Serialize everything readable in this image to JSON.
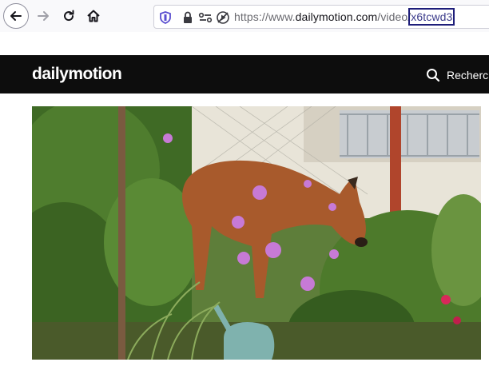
{
  "browser": {
    "url": {
      "prefix": "https://www.",
      "domain": "dailymotion.com",
      "path": "/video/",
      "video_id": "x6tcwd3"
    },
    "icons": [
      "back-icon",
      "forward-icon",
      "reload-icon",
      "home-icon",
      "shield-icon",
      "lock-icon",
      "permissions-icon",
      "autoplay-blocked-icon"
    ]
  },
  "site": {
    "logo": "dailymotion",
    "search_label": "Recherch"
  },
  "video": {
    "subject": "deer-in-garden-frame"
  },
  "colors": {
    "header_bg": "#0d0d0d",
    "url_highlight": "#1e1e7a"
  }
}
